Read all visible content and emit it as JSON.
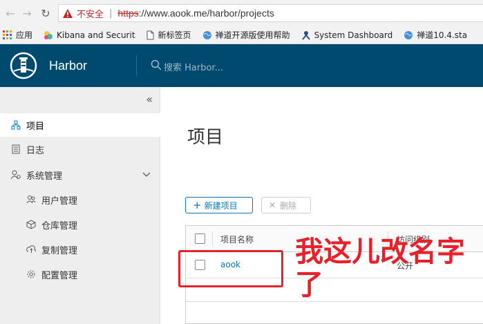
{
  "browser": {
    "security_label": "不安全",
    "url_scheme": "https",
    "url_rest": "://www.aook.me/harbor/projects",
    "bookmarks": [
      {
        "label": "应用",
        "icon": "apps-grid-icon"
      },
      {
        "label": "Kibana and Securit",
        "icon": "kibana-icon"
      },
      {
        "label": "新标签页",
        "icon": "page-icon"
      },
      {
        "label": "禅道开源版使用帮助",
        "icon": "globe-icon"
      },
      {
        "label": "System Dashboard",
        "icon": "jira-icon"
      },
      {
        "label": "禅道10.4.sta",
        "icon": "globe-icon"
      }
    ]
  },
  "header": {
    "brand": "Harbor",
    "search_placeholder": "搜索 Harbor...",
    "color": "#004a70"
  },
  "sidebar": {
    "collapse_icon": "double-chevron-left-icon",
    "items": [
      {
        "label": "项目",
        "icon": "project-icon",
        "active": true
      },
      {
        "label": "日志",
        "icon": "log-icon"
      },
      {
        "label": "系统管理",
        "icon": "admin-icon",
        "expanded": true
      },
      {
        "label": "用户管理",
        "icon": "users-icon"
      },
      {
        "label": "仓库管理",
        "icon": "registry-icon"
      },
      {
        "label": "复制管理",
        "icon": "replication-icon"
      },
      {
        "label": "配置管理",
        "icon": "config-icon"
      }
    ]
  },
  "main": {
    "title": "项目",
    "new_project_button": "新建项目",
    "delete_button": "删除",
    "columns": [
      "项目名称",
      "访问级别"
    ],
    "rows": [
      {
        "name": "aook",
        "access": "公开"
      }
    ]
  },
  "annotation": {
    "note": "我这儿改名字了",
    "color": "#e8202a"
  }
}
